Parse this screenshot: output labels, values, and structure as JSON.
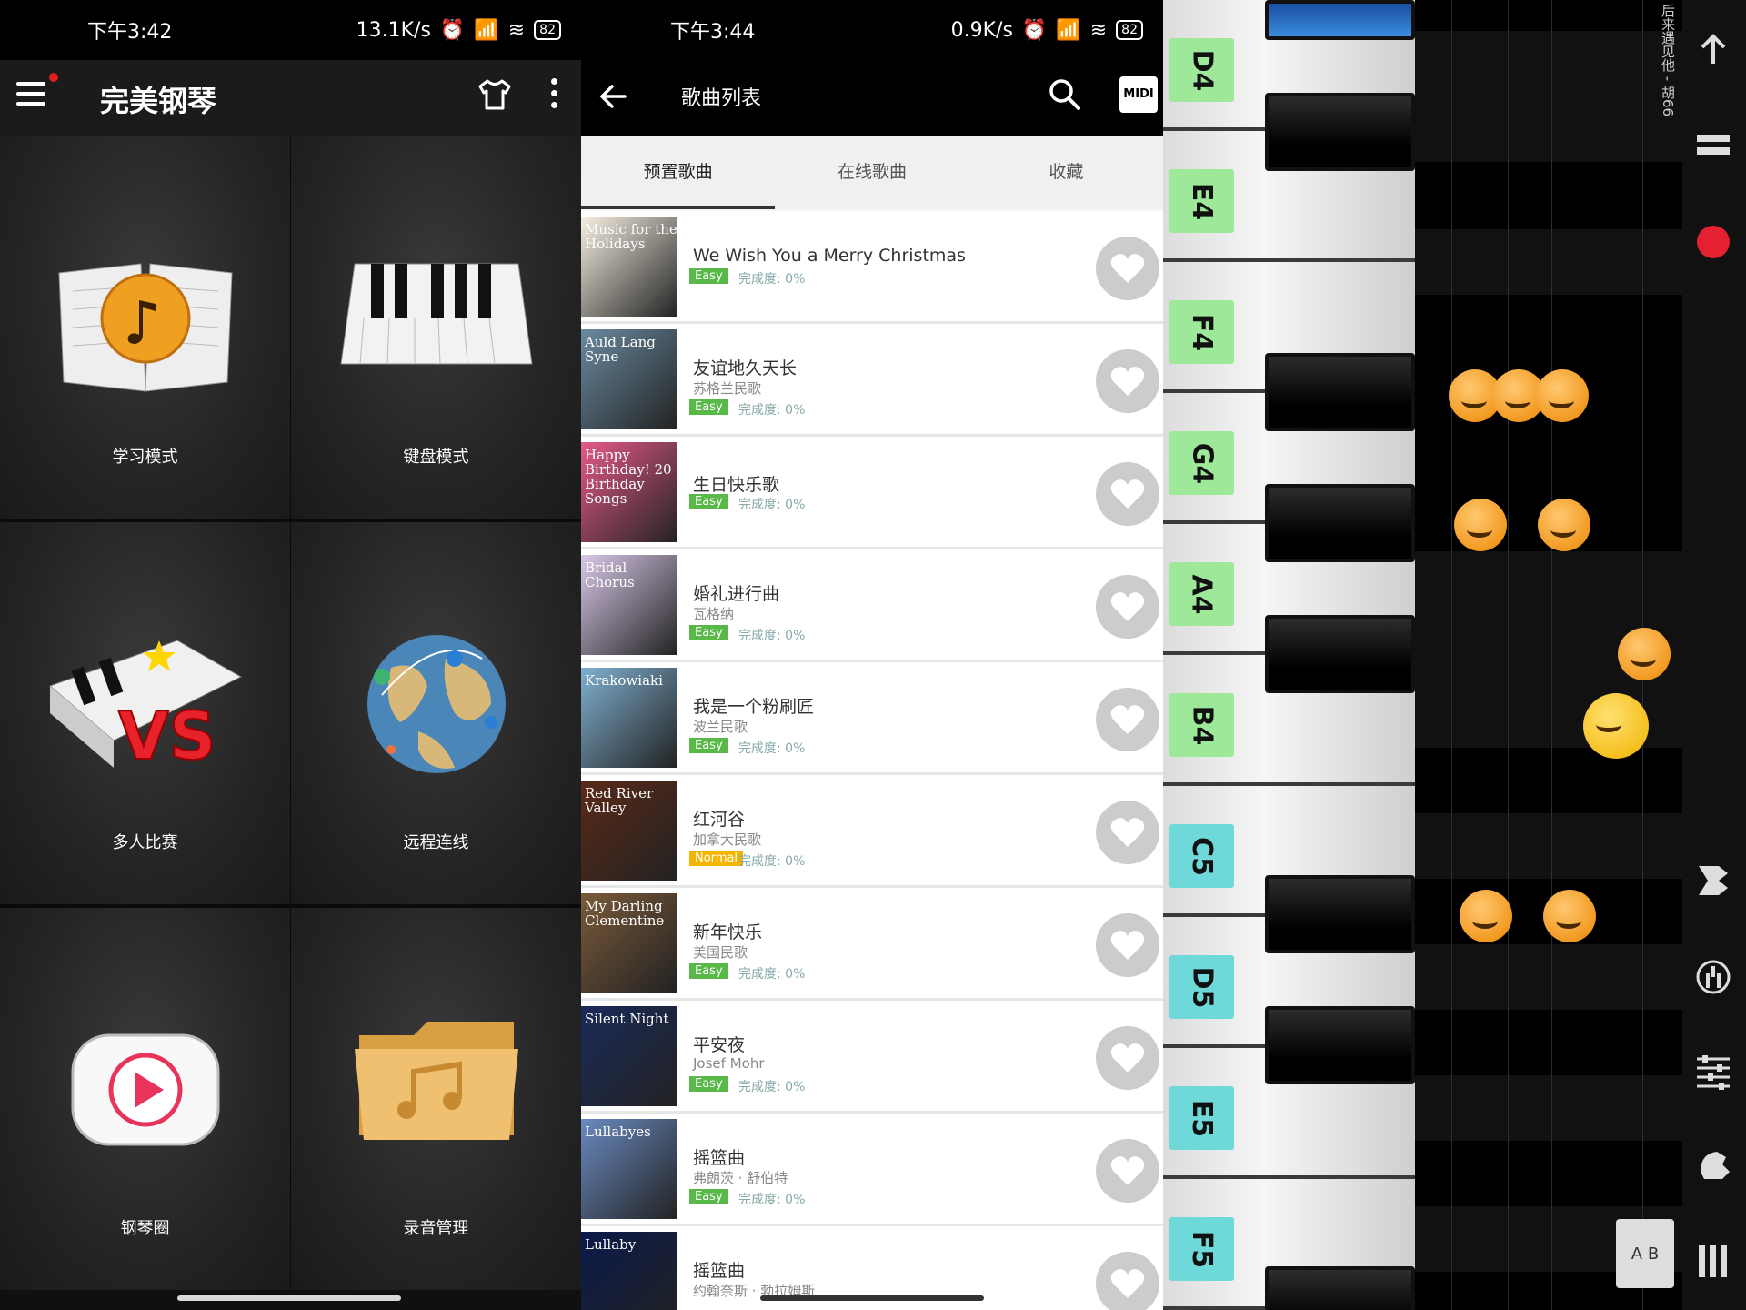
{
  "panel1": {
    "status": {
      "time": "下午3:42",
      "speed": "13.1K/s",
      "battery": "82"
    },
    "app_title": "完美钢琴",
    "tiles": [
      {
        "label": "学习模式",
        "icon": "book-note-icon"
      },
      {
        "label": "键盘模式",
        "icon": "piano-keys-icon"
      },
      {
        "label": "多人比赛",
        "icon": "versus-icon"
      },
      {
        "label": "远程连线",
        "icon": "globe-icon"
      },
      {
        "label": "钢琴圈",
        "icon": "play-icon"
      },
      {
        "label": "录音管理",
        "icon": "folder-icon"
      }
    ]
  },
  "panel2": {
    "status": {
      "time": "下午3:44",
      "speed": "0.9K/s",
      "battery": "82"
    },
    "title": "歌曲列表",
    "midi_label": "MIDI",
    "tabs": [
      "预置歌曲",
      "在线歌曲",
      "收藏"
    ],
    "progress_prefix": "完成度: ",
    "songs": [
      {
        "title": "We Wish You a Merry Christmas",
        "artist": "",
        "level": "Easy",
        "progress": "0%",
        "cover_text": "Music for the Holidays",
        "cover_color": "#f7f0e3"
      },
      {
        "title": "友谊地久天长",
        "artist": "苏格兰民歌",
        "level": "Easy",
        "progress": "0%",
        "cover_text": "Auld Lang Syne",
        "cover_color": "#6a8aa0"
      },
      {
        "title": "生日快乐歌",
        "artist": "",
        "level": "Easy",
        "progress": "0%",
        "cover_text": "Happy Birthday! 20 Birthday Songs",
        "cover_color": "#e55a8a"
      },
      {
        "title": "婚礼进行曲",
        "artist": "瓦格纳",
        "level": "Easy",
        "progress": "0%",
        "cover_text": "Bridal Chorus",
        "cover_color": "#d8c8e8"
      },
      {
        "title": "我是一个粉刷匠",
        "artist": "波兰民歌",
        "level": "Easy",
        "progress": "0%",
        "cover_text": "Krakowiaki",
        "cover_color": "#7fb0d0"
      },
      {
        "title": "红河谷",
        "artist": "加拿大民歌",
        "level": "Normal",
        "progress": "0%",
        "cover_text": "Red River Valley",
        "cover_color": "#5a2a18"
      },
      {
        "title": "新年快乐",
        "artist": "美国民歌",
        "level": "Easy",
        "progress": "0%",
        "cover_text": "My Darling Clementine",
        "cover_color": "#7a5a3a"
      },
      {
        "title": "平安夜",
        "artist": "Josef Mohr",
        "level": "Easy",
        "progress": "0%",
        "cover_text": "Silent Night",
        "cover_color": "#1a2a5a"
      },
      {
        "title": "摇篮曲",
        "artist": "弗朗茨 · 舒伯特",
        "level": "Easy",
        "progress": "0%",
        "cover_text": "Lullabyes",
        "cover_color": "#6a8ac0"
      },
      {
        "title": "摇篮曲",
        "artist": "约翰奈斯 · 勃拉姆斯",
        "level": "",
        "progress": "",
        "cover_text": "Lullaby",
        "cover_color": "#0a1a4a"
      }
    ],
    "colors": {
      "easy": "#58b848",
      "normal": "#f5b400"
    }
  },
  "panel3": {
    "note_labels": [
      {
        "name": "D4",
        "color": "#9ee89a"
      },
      {
        "name": "E4",
        "color": "#9ee89a"
      },
      {
        "name": "F4",
        "color": "#9ee89a"
      },
      {
        "name": "G4",
        "color": "#9ee89a"
      },
      {
        "name": "A4",
        "color": "#9ee89a"
      },
      {
        "name": "B4",
        "color": "#9ee89a"
      },
      {
        "name": "C5",
        "color": "#6fd8d8"
      },
      {
        "name": "D5",
        "color": "#6fd8d8"
      },
      {
        "name": "E5",
        "color": "#6fd8d8"
      },
      {
        "name": "F5",
        "color": "#6fd8d8"
      }
    ],
    "song_name": "后来遇见他 - 胡66",
    "side_icons": [
      "arrow-up-icon",
      "menu-bars-icon",
      "record-icon",
      "pedal-icon",
      "metronome-icon",
      "equalizer-icon",
      "speed-icon",
      "keyboard-size-icon"
    ],
    "loop_label": "A B"
  }
}
